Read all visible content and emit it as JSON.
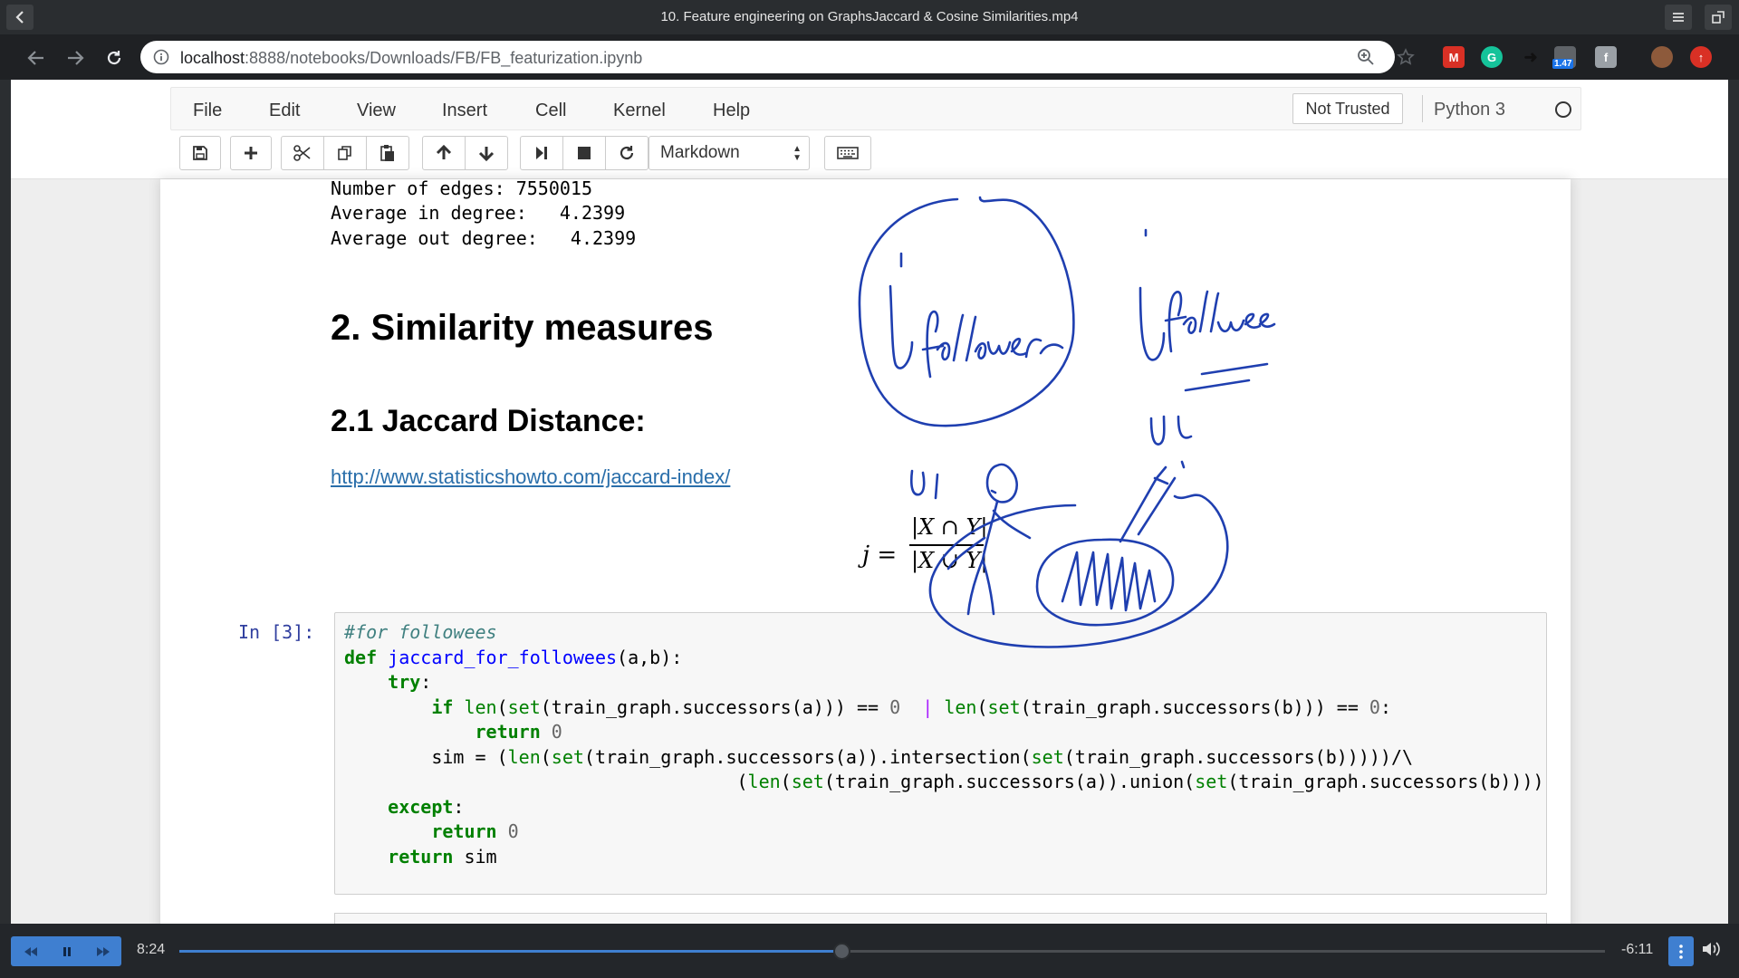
{
  "player": {
    "title": "10. Feature engineering on GraphsJaccard & Cosine Similarities.mp4",
    "elapsed": "8:24",
    "remaining": "-6:11",
    "progress": 0.465
  },
  "browser": {
    "url_host": "localhost",
    "url_path": ":8888/notebooks/Downloads/FB/FB_featurization.ipynb",
    "extension_badge": "1.47"
  },
  "jupyter": {
    "menu": [
      "File",
      "Edit",
      "View",
      "Insert",
      "Cell",
      "Kernel",
      "Help"
    ],
    "not_trusted": "Not Trusted",
    "kernel": "Python 3",
    "cell_type": "Markdown"
  },
  "notebook": {
    "output_lines": [
      "Number of edges: 7550015",
      "Average in degree:   4.2399",
      "Average out degree:   4.2399"
    ],
    "heading": "2. Similarity measures",
    "subheading": "2.1 Jaccard Distance:",
    "link": "http://www.statisticshowto.com/jaccard-index/",
    "formula_lhs": "j =",
    "formula_num": "|X ∩ Y|",
    "formula_den": "|X ∪ Y|",
    "prompt": "In [3]:"
  },
  "annotations": {
    "left_text": "followers",
    "right_text": "followee",
    "label_u1": "U1",
    "label_u2": "U2"
  }
}
